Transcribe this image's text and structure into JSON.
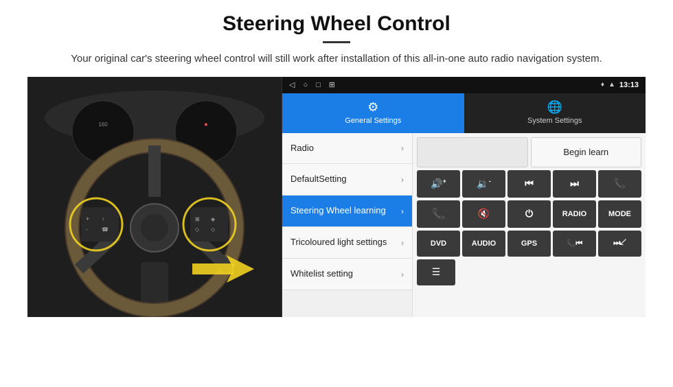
{
  "header": {
    "title": "Steering Wheel Control",
    "subtitle": "Your original car's steering wheel control will still work after installation of this all-in-one auto radio navigation system."
  },
  "status_bar": {
    "time": "13:13",
    "icons": [
      "◁",
      "○",
      "□",
      "⊞"
    ]
  },
  "tabs": [
    {
      "id": "general",
      "label": "General Settings",
      "icon": "⚙",
      "active": true
    },
    {
      "id": "system",
      "label": "System Settings",
      "icon": "🌐",
      "active": false
    }
  ],
  "menu_items": [
    {
      "id": "radio",
      "label": "Radio",
      "active": false
    },
    {
      "id": "default",
      "label": "DefaultSetting",
      "active": false
    },
    {
      "id": "steering",
      "label": "Steering Wheel learning",
      "active": true
    },
    {
      "id": "tricoloured",
      "label": "Tricoloured light settings",
      "active": false
    },
    {
      "id": "whitelist",
      "label": "Whitelist setting",
      "active": false
    }
  ],
  "controls": {
    "begin_learn": "Begin learn",
    "row1": [
      {
        "icon": "🔊+",
        "label": "vol-up"
      },
      {
        "icon": "🔊-",
        "label": "vol-down"
      },
      {
        "icon": "⏮",
        "label": "prev"
      },
      {
        "icon": "⏭",
        "label": "next"
      },
      {
        "icon": "📞",
        "label": "call"
      }
    ],
    "row2": [
      {
        "icon": "📞",
        "label": "call-accept"
      },
      {
        "icon": "🔇",
        "label": "mute"
      },
      {
        "icon": "⏻",
        "label": "power"
      },
      {
        "text": "RADIO",
        "label": "radio-btn"
      },
      {
        "text": "MODE",
        "label": "mode-btn"
      }
    ],
    "row3": [
      {
        "text": "DVD",
        "label": "dvd-btn"
      },
      {
        "text": "AUDIO",
        "label": "audio-btn"
      },
      {
        "text": "GPS",
        "label": "gps-btn"
      },
      {
        "icon": "📞⏮",
        "label": "call-prev"
      },
      {
        "icon": "⏭↙",
        "label": "next-alt"
      }
    ],
    "row4": [
      {
        "icon": "≡",
        "label": "menu-icon"
      }
    ]
  }
}
